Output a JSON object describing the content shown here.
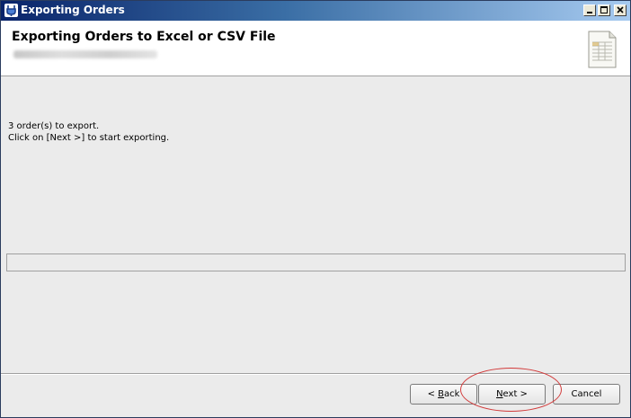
{
  "window": {
    "title": "Exporting Orders",
    "controls": [
      "minimize-icon",
      "maximize-icon",
      "close-icon"
    ]
  },
  "header": {
    "title": "Exporting Orders to Excel or CSV File",
    "icon": "spreadsheet-document-icon"
  },
  "main": {
    "line1": "3 order(s) to export.",
    "line2": "Click on [Next >] to start exporting.",
    "progress_fraction": 0
  },
  "buttons": {
    "back_prefix": "< ",
    "back_mnemonic": "B",
    "back_rest": "ack",
    "next_mnemonic": "N",
    "next_rest": "ext >",
    "cancel": "Cancel"
  },
  "annotation": {
    "color": "#d23a3a"
  }
}
